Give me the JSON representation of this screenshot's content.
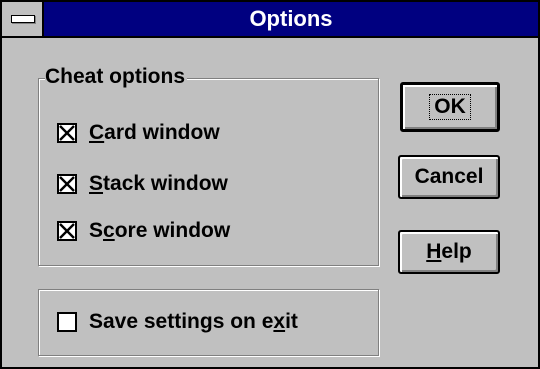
{
  "window": {
    "title": "Options"
  },
  "cheat_group": {
    "legend": "Cheat options",
    "options": [
      {
        "label_pre": "",
        "label_key": "C",
        "label_post": "ard window",
        "checked": true
      },
      {
        "label_pre": "",
        "label_key": "S",
        "label_post": "tack window",
        "checked": true
      },
      {
        "label_pre": "S",
        "label_key": "c",
        "label_post": "ore window",
        "checked": true
      }
    ]
  },
  "save_group": {
    "label_pre": "Save settings on e",
    "label_key": "x",
    "label_post": "it",
    "checked": false
  },
  "buttons": {
    "ok": "OK",
    "cancel": "Cancel",
    "help_key": "H",
    "help_rest": "elp"
  }
}
